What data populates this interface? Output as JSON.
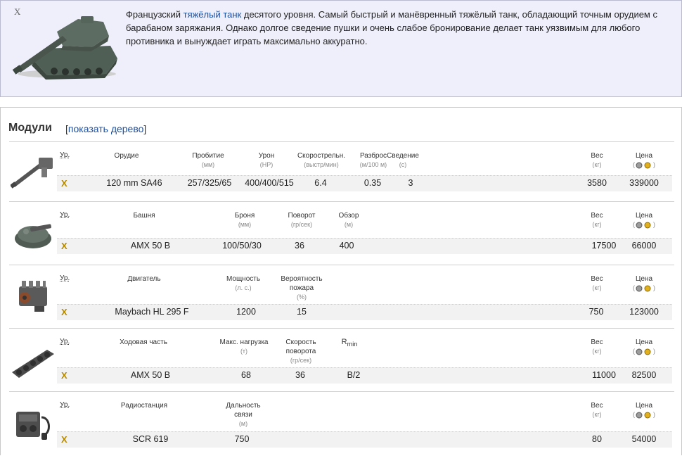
{
  "description": {
    "tier_mark": "X",
    "text_before": "Французский ",
    "link_text": "тяжёлый танк",
    "text_after": " десятого уровня. Самый быстрый и манёвренный тяжёлый танк, обладающий точным орудием с барабаном заряжания. Однако долгое сведение пушки и очень слабое бронирование делает танк уязвимым для любого противника и вынуждает играть максимально аккуратно."
  },
  "modules": {
    "title": "Модули",
    "tree_link_open": "[",
    "tree_link": "показать дерево",
    "tree_link_close": "]",
    "level_header": "Ур.",
    "weight_header": "Вес",
    "weight_unit": "(кг)",
    "price_header": "Цена",
    "price_open": "(",
    "price_close": ")",
    "tier_value": "X",
    "gun": {
      "col_name": "Орудие",
      "col_pen": "Пробитие",
      "unit_pen": "(мм)",
      "col_dmg": "Урон",
      "unit_dmg": "(HP)",
      "col_rof": "Скорострельн.",
      "unit_rof": "(выстр/мин)",
      "col_disp": "Разброс",
      "unit_disp": "(м/100 м)",
      "col_aim": "Сведение",
      "unit_aim": "(с)",
      "name": "120 mm SA46",
      "pen": "257/325/65",
      "dmg": "400/400/515",
      "rof": "6.4",
      "disp": "0.35",
      "aim": "3",
      "weight": "3580",
      "price": "339000"
    },
    "turret": {
      "col_name": "Башня",
      "col_armor": "Броня",
      "unit_armor": "(мм)",
      "col_trav": "Поворот",
      "unit_trav": "(гр/сек)",
      "col_view": "Обзор",
      "unit_view": "(м)",
      "name": "AMX 50 B",
      "armor": "100/50/30",
      "trav": "36",
      "view": "400",
      "weight": "17500",
      "price": "66000"
    },
    "engine": {
      "col_name": "Двигатель",
      "col_power": "Мощность",
      "unit_power": "(л. с.)",
      "col_fire1": "Вероятность",
      "col_fire2": "пожара",
      "unit_fire": "(%)",
      "name": "Maybach HL 295 F",
      "power": "1200",
      "fire": "15",
      "weight": "750",
      "price": "123000"
    },
    "suspension": {
      "col_name": "Ходовая часть",
      "col_load": "Макс. нагрузка",
      "unit_load": "(т)",
      "col_spd1": "Скорость",
      "col_spd2": "поворота",
      "unit_spd": "(гр/сек)",
      "col_r": "R",
      "col_r_sub": "min",
      "name": "AMX 50 B",
      "load": "68",
      "spd": "36",
      "r": "B/2",
      "weight": "11000",
      "price": "82500"
    },
    "radio": {
      "col_name": "Радиостанция",
      "col_range1": "Дальность",
      "col_range2": "связи",
      "unit_range": "(м)",
      "name": "SCR 619",
      "range": "750",
      "weight": "80",
      "price": "54000"
    }
  }
}
